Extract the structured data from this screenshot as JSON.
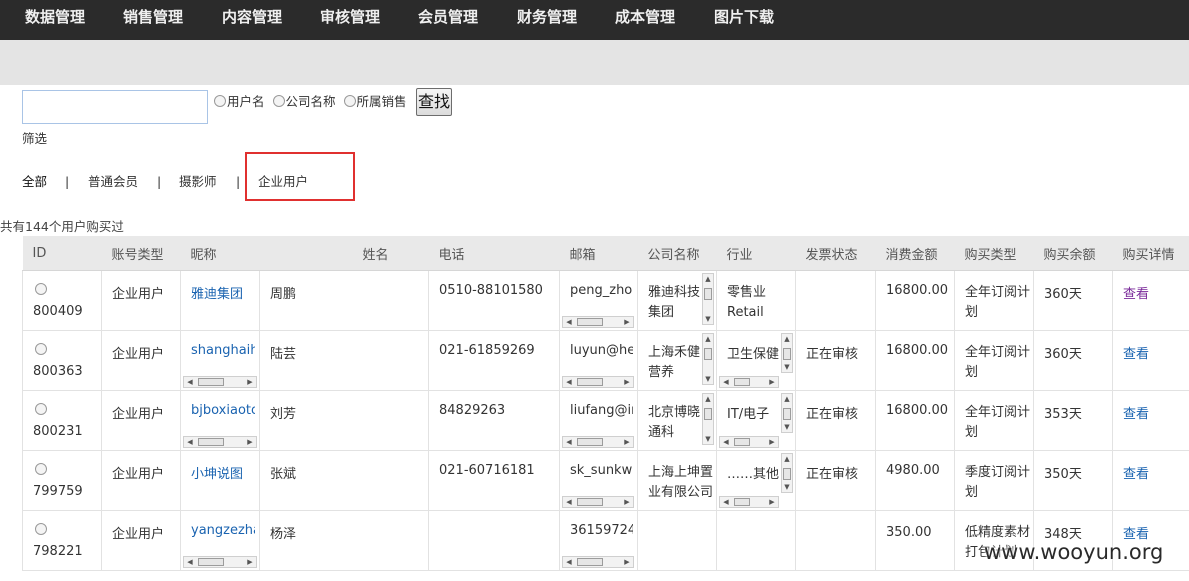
{
  "topnav": [
    {
      "label": "数据管理"
    },
    {
      "label": "销售管理"
    },
    {
      "label": "内容管理"
    },
    {
      "label": "审核管理"
    },
    {
      "label": "会员管理"
    },
    {
      "label": "财务管理"
    },
    {
      "label": "成本管理"
    },
    {
      "label": "图片下载"
    }
  ],
  "search": {
    "value": "",
    "placeholder": "",
    "options": [
      "用户名",
      "公司名称",
      "所属销售"
    ],
    "button": "查找",
    "filter_label": "筛选"
  },
  "tabs": {
    "items": [
      "全部",
      "普通会员",
      "摄影师",
      "企业用户"
    ],
    "separator": "|"
  },
  "summary": "共有144个用户购买过",
  "table": {
    "headers": [
      "ID",
      "账号类型",
      "昵称",
      "姓名",
      "电话",
      "邮箱",
      "公司名称",
      "行业",
      "发票状态",
      "消费金额",
      "购买类型",
      "购买余额",
      "购买详情"
    ],
    "rows": [
      {
        "id": "800409",
        "type": "企业用户",
        "nick": "雅迪集团",
        "name": "周鹏",
        "phone": "0510-88101580",
        "email": "peng_zhou",
        "company": "雅迪科技集团",
        "industry": "零售业 Retail",
        "invoice": "",
        "amount": "16800.00",
        "ptype": "全年订阅计划",
        "balance": "360天",
        "detail": "查看"
      },
      {
        "id": "800363",
        "type": "企业用户",
        "nick": "shanghaih",
        "name": "陆芸",
        "phone": "021-61859269",
        "email": "luyun@he",
        "company": "上海禾健营养",
        "industry": "卫生保健",
        "invoice": "正在审核",
        "amount": "16800.00",
        "ptype": "全年订阅计划",
        "balance": "360天",
        "detail": "查看"
      },
      {
        "id": "800231",
        "type": "企业用户",
        "nick": "bjboxiaoto",
        "name": "刘芳",
        "phone": "84829263",
        "email": "liufang@in",
        "company": "北京博晓通科",
        "industry": "IT/电子",
        "invoice": "正在审核",
        "amount": "16800.00",
        "ptype": "全年订阅计划",
        "balance": "353天",
        "detail": "查看"
      },
      {
        "id": "799759",
        "type": "企业用户",
        "nick": "小坤说图",
        "name": "张斌",
        "phone": "021-60716181",
        "email": "sk_sunkwa",
        "company": "上海上坤置业有限公司",
        "industry": "……其他",
        "invoice": "正在审核",
        "amount": "4980.00",
        "ptype": "季度订阅计划",
        "balance": "350天",
        "detail": "查看"
      },
      {
        "id": "798221",
        "type": "企业用户",
        "nick": "yangzezha",
        "name": "杨泽",
        "phone": "",
        "email": "36159724",
        "company": "",
        "industry": "",
        "invoice": "",
        "amount": "350.00",
        "ptype": "低精度素材打包计划",
        "balance": "348天",
        "detail": "查看"
      }
    ]
  },
  "watermark": "www.wooyun.org"
}
